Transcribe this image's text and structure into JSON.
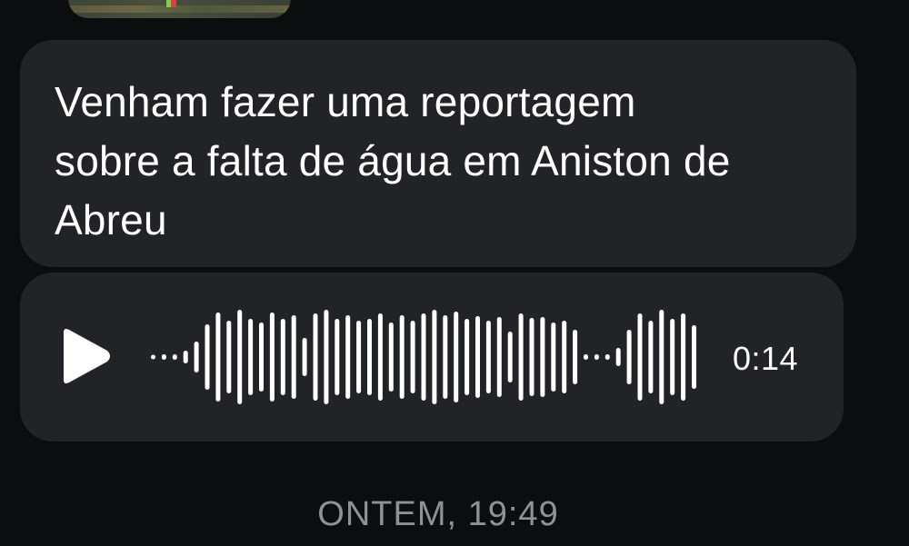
{
  "messages": {
    "text_message": "Venham fazer uma reportagem\nsobre a falta de água em Aniston de\nAbreu",
    "voice_message": {
      "duration": "0:14",
      "play_icon": "play-icon"
    }
  },
  "date_separator": "ONTEM, 19:49",
  "colors": {
    "background": "#0c0d0f",
    "bubble": "#222327",
    "text": "#ffffff",
    "timestamp": "#8e9196"
  }
}
